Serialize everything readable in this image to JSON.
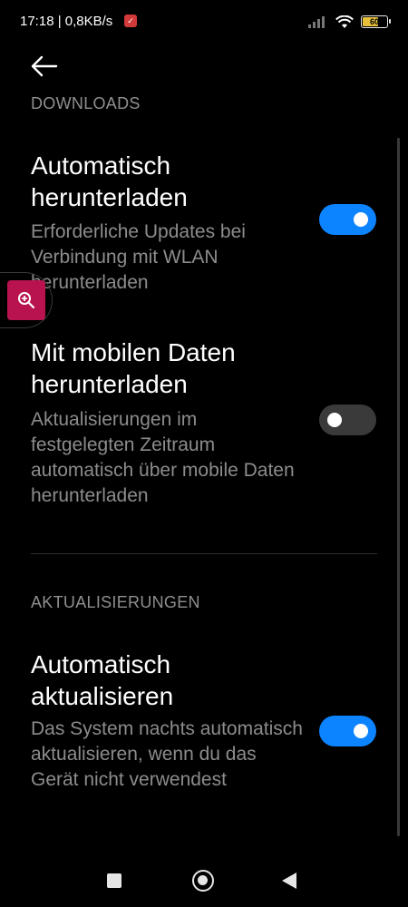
{
  "status_bar": {
    "time": "17:18",
    "network_speed": "0,8KB/s",
    "battery_level": "60"
  },
  "sections": [
    {
      "header": "DOWNLOADS",
      "items": [
        {
          "title": "Automatisch herunterladen",
          "description": "Erforderliche Updates bei Verbindung mit WLAN herunterladen",
          "enabled": true
        },
        {
          "title": "Mit mobilen Daten herunterladen",
          "description": "Aktualisierungen im festgelegten Zeitraum automatisch über mobile Daten herunterladen",
          "enabled": false
        }
      ]
    },
    {
      "header": "AKTUALISIERUNGEN",
      "items": [
        {
          "title": "Automatisch aktualisieren",
          "description": "Das System nachts automatisch aktualisieren, wenn du das Gerät nicht verwendest",
          "enabled": true
        }
      ]
    }
  ],
  "colors": {
    "toggle_on": "#0d84ff",
    "toggle_off": "#3a3a3a",
    "zoom_bubble": "#b8134f"
  },
  "icons": {
    "back": "arrow-left-icon",
    "zoom": "zoom-in-icon",
    "recents": "square-icon",
    "home": "circle-icon",
    "nav_back": "triangle-left-icon"
  }
}
